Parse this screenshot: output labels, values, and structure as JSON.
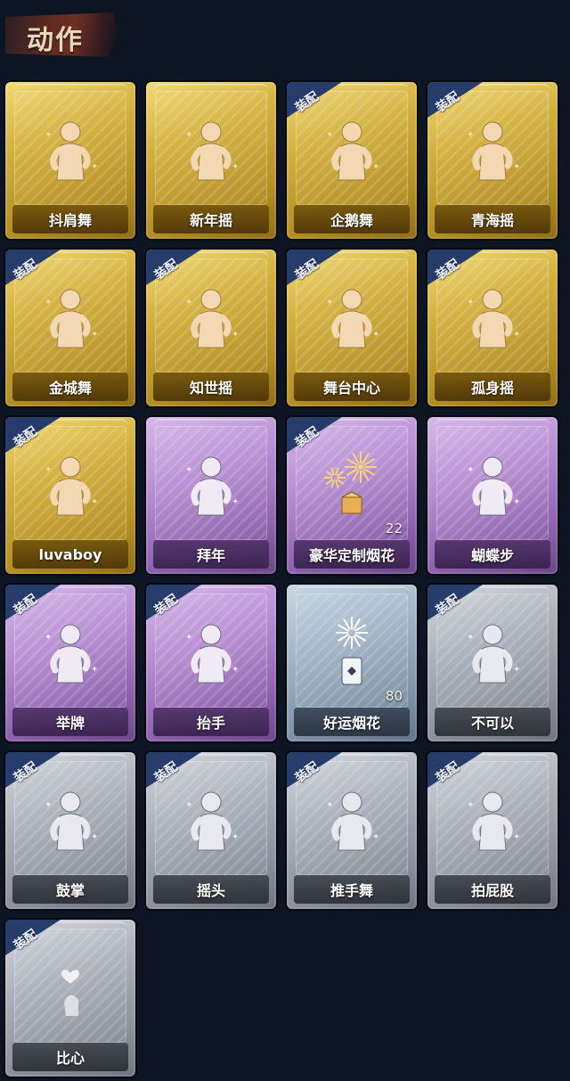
{
  "header": {
    "title": "动作"
  },
  "badge_text": "装配",
  "cards": [
    {
      "label": "抖肩舞",
      "rarity": "gold",
      "equipped": false,
      "icon": "shoulder-shake-dance-icon"
    },
    {
      "label": "新年摇",
      "rarity": "gold",
      "equipped": false,
      "icon": "new-year-sway-icon"
    },
    {
      "label": "企鹅舞",
      "rarity": "gold",
      "equipped": true,
      "icon": "penguin-dance-icon"
    },
    {
      "label": "青海摇",
      "rarity": "gold",
      "equipped": true,
      "icon": "qinghai-sway-icon"
    },
    {
      "label": "金城舞",
      "rarity": "gold",
      "equipped": true,
      "icon": "jincheng-dance-icon"
    },
    {
      "label": "知世摇",
      "rarity": "gold",
      "equipped": true,
      "icon": "zhishi-sway-icon"
    },
    {
      "label": "舞台中心",
      "rarity": "gold",
      "equipped": true,
      "icon": "stage-center-icon"
    },
    {
      "label": "孤身摇",
      "rarity": "gold",
      "equipped": true,
      "icon": "solo-sway-icon"
    },
    {
      "label": "luvaboy",
      "rarity": "gold",
      "equipped": true,
      "icon": "luvaboy-pose-icon"
    },
    {
      "label": "拜年",
      "rarity": "purple",
      "equipped": false,
      "icon": "new-year-greeting-icon"
    },
    {
      "label": "豪华定制烟花",
      "rarity": "purple",
      "equipped": true,
      "icon": "fireworks-box-icon",
      "count": "22"
    },
    {
      "label": "蝴蝶步",
      "rarity": "purple",
      "equipped": false,
      "icon": "butterfly-step-icon"
    },
    {
      "label": "举牌",
      "rarity": "purple",
      "equipped": true,
      "icon": "hold-sign-icon"
    },
    {
      "label": "抬手",
      "rarity": "purple",
      "equipped": true,
      "icon": "raise-hand-icon"
    },
    {
      "label": "好运烟花",
      "rarity": "blue",
      "equipped": false,
      "icon": "lucky-firework-icon",
      "count": "80"
    },
    {
      "label": "不可以",
      "rarity": "gray",
      "equipped": true,
      "icon": "finger-wag-icon"
    },
    {
      "label": "鼓掌",
      "rarity": "gray",
      "equipped": true,
      "icon": "clapping-icon"
    },
    {
      "label": "摇头",
      "rarity": "gray",
      "equipped": true,
      "icon": "head-shake-icon"
    },
    {
      "label": "推手舞",
      "rarity": "gray",
      "equipped": true,
      "icon": "push-hand-dance-icon"
    },
    {
      "label": "拍屁股",
      "rarity": "gray",
      "equipped": true,
      "icon": "butt-slap-icon"
    },
    {
      "label": "比心",
      "rarity": "gray",
      "equipped": true,
      "icon": "heart-gesture-icon"
    }
  ]
}
